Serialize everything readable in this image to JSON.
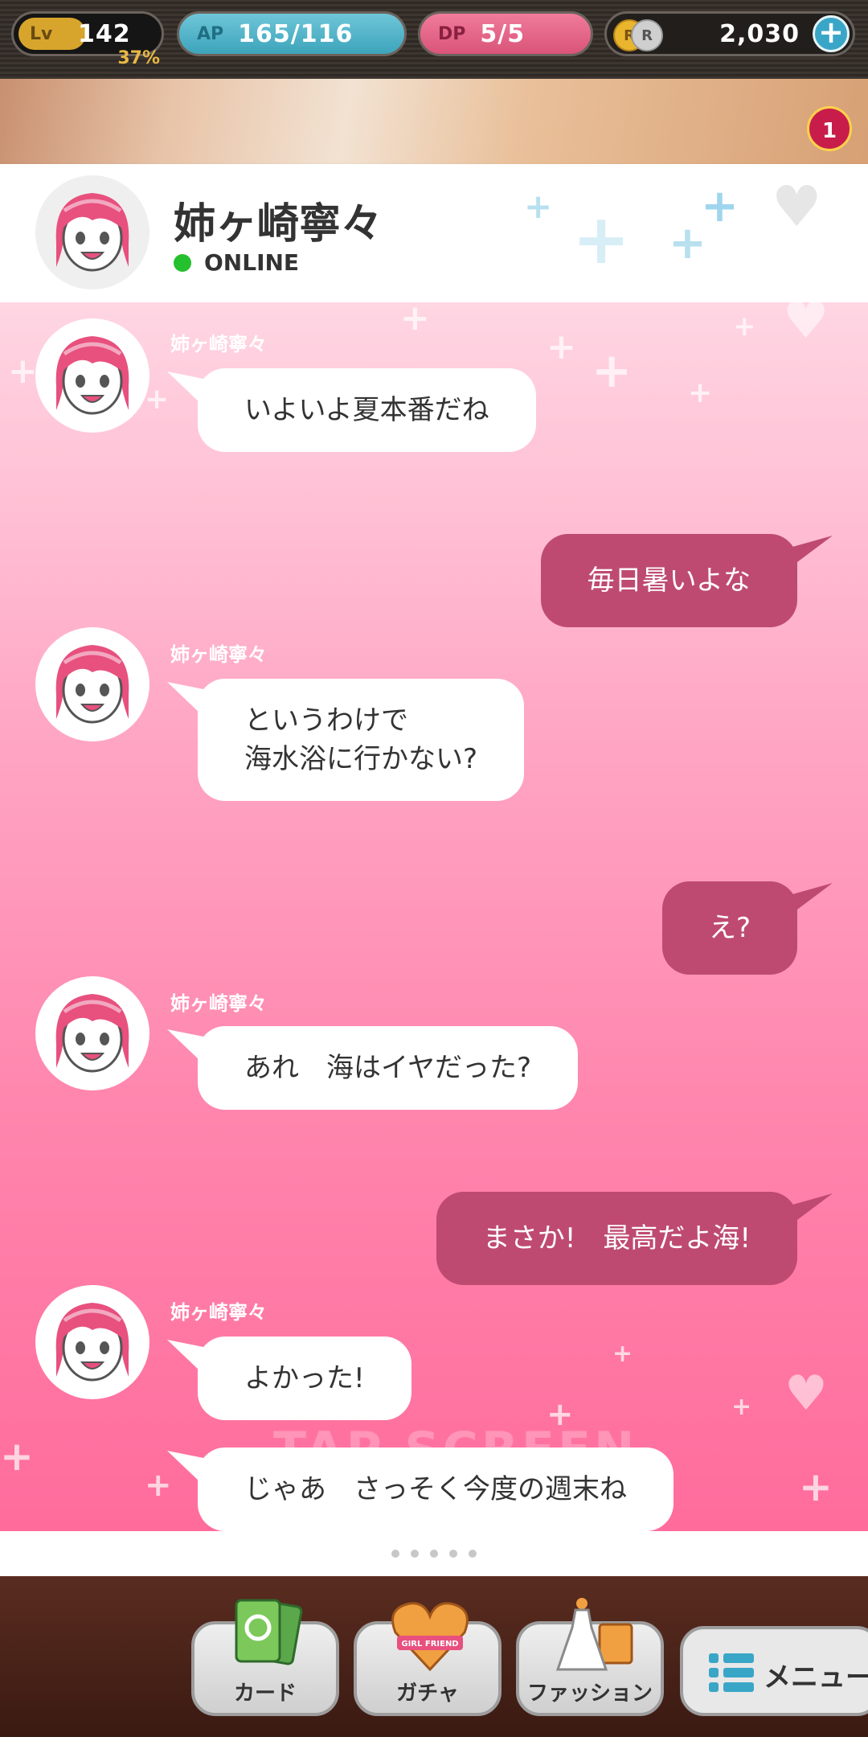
{
  "status_bar": {
    "level_label": "Lv",
    "level": "142",
    "level_progress": "37%",
    "ap_label": "AP",
    "ap_value": "165/116",
    "dp_label": "DP",
    "dp_value": "5/5",
    "coin_icons": [
      "R",
      "R"
    ],
    "coins": "2,030"
  },
  "notification_count": "1",
  "header": {
    "name": "姉ヶ崎寧々",
    "status": "ONLINE",
    "status_color": "#25c02e"
  },
  "messages": [
    {
      "side": "left",
      "sender": "姉ヶ崎寧々",
      "lines": [
        "いよいよ夏本番だね"
      ]
    },
    {
      "side": "right",
      "lines": [
        "毎日暑いよな"
      ]
    },
    {
      "side": "left",
      "sender": "姉ヶ崎寧々",
      "lines": [
        "というわけで",
        "海水浴に行かない?"
      ]
    },
    {
      "side": "right",
      "lines": [
        "え?"
      ]
    },
    {
      "side": "left",
      "sender": "姉ヶ崎寧々",
      "lines": [
        "あれ　海はイヤだった?"
      ]
    },
    {
      "side": "right",
      "lines": [
        "まさか!　最高だよ海!"
      ]
    },
    {
      "side": "left",
      "sender": "姉ヶ崎寧々",
      "lines": [
        "よかった!"
      ]
    },
    {
      "side": "left",
      "lines": [
        "じゃあ　さっそく今度の週末ね"
      ]
    }
  ],
  "watermark": "TAP SCREEN",
  "pager": {
    "dots": 5
  },
  "nav": {
    "card_label": "カード",
    "gacha_label": "ガチャ",
    "gacha_badge": "GIRL FRIEND",
    "fashion_label": "ファッション",
    "menu_label": "メニュー"
  },
  "colors": {
    "bubble_right": "#be4a72",
    "bubble_left": "#ffffff",
    "chat_bg_top": "#ffd6e3",
    "chat_bg_bottom": "#ff6c9c"
  }
}
